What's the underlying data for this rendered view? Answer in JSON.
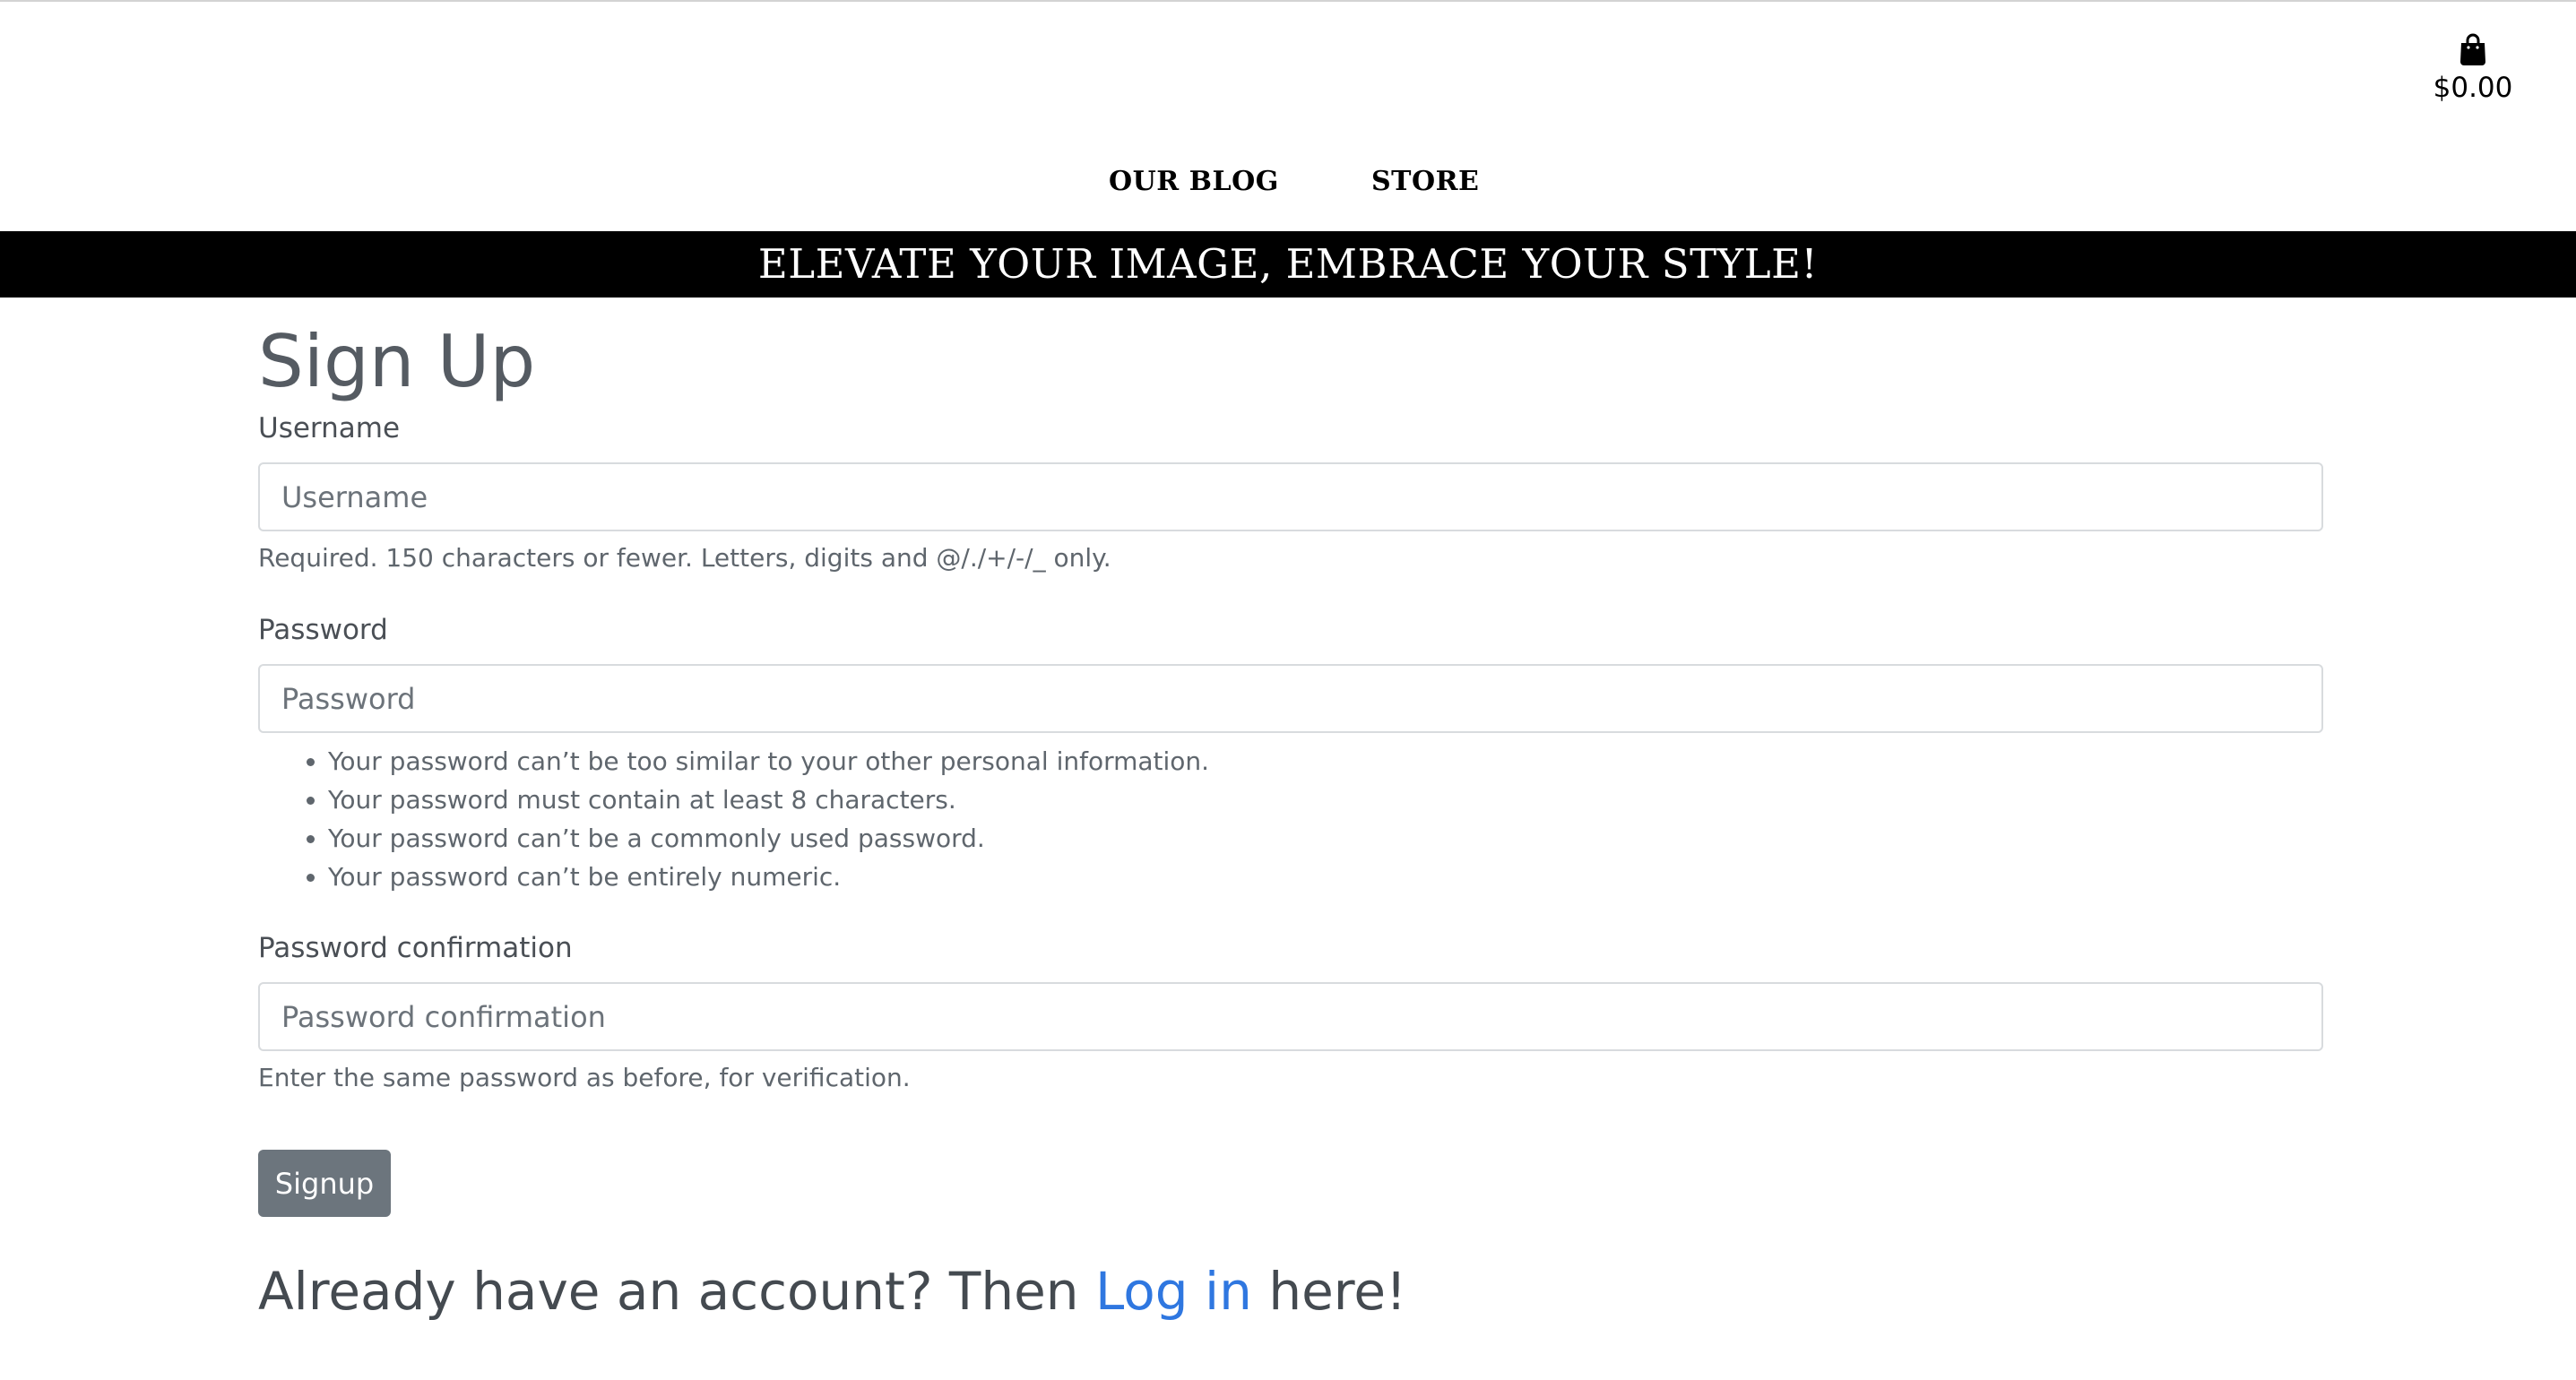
{
  "header": {
    "cart_icon": "shopping-bag-icon",
    "cart_total": "$0.00",
    "nav": {
      "blog_label": "OUR BLOG",
      "store_label": "STORE"
    },
    "banner_text": "ELEVATE YOUR IMAGE, EMBRACE YOUR STYLE!"
  },
  "form": {
    "title": "Sign Up",
    "username": {
      "label": "Username",
      "value": "",
      "placeholder": "Username",
      "help": "Required. 150 characters or fewer. Letters, digits and @/./+/-/_ only."
    },
    "password": {
      "label": "Password",
      "value": "",
      "placeholder": "Password",
      "rules": [
        "Your password can’t be too similar to your other personal information.",
        "Your password must contain at least 8 characters.",
        "Your password can’t be a commonly used password.",
        "Your password can’t be entirely numeric."
      ]
    },
    "password_confirmation": {
      "label": "Password confirmation",
      "value": "",
      "placeholder": "Password confirmation",
      "help": "Enter the same password as before, for verification."
    },
    "submit_label": "Signup"
  },
  "login_prompt": {
    "before": "Already have an account? Then ",
    "link_text": "Log in",
    "after": " here!"
  },
  "colors": {
    "banner_background": "#000000",
    "button_background": "#6c757d",
    "link": "#2f77e0"
  }
}
